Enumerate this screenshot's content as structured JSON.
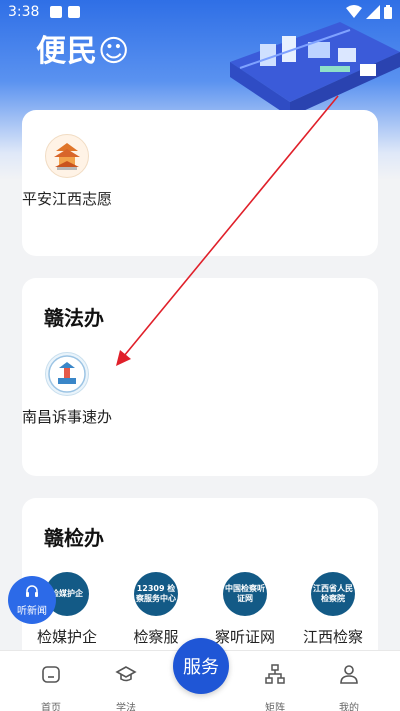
{
  "status_bar": {
    "time": "3:38"
  },
  "hero": {
    "title": "便民☺"
  },
  "sections": [
    {
      "title": "",
      "apps": [
        {
          "label": "平安江西志愿",
          "icon": "pavilion-icon"
        }
      ]
    },
    {
      "title": "赣法办",
      "apps": [
        {
          "label": "南昌诉事速办",
          "icon": "court-emblem-icon"
        }
      ]
    },
    {
      "title": "赣检办",
      "apps": [
        {
          "label": "检媒护企",
          "icon_text": "检媒护企"
        },
        {
          "label": "检察服",
          "icon_text": "12309 检察服务中心"
        },
        {
          "label": "察听证网",
          "icon_text": "中国检察听证网"
        },
        {
          "label": "江西检察",
          "icon_text": "江西省人民检察院"
        }
      ]
    }
  ],
  "floating": {
    "listen_news": "听新闻"
  },
  "bottom_nav": {
    "items": [
      {
        "label": "首页"
      },
      {
        "label": "学法"
      },
      {
        "label": "矩阵"
      },
      {
        "label": "我的"
      }
    ],
    "service": "服务"
  },
  "colors": {
    "primary": "#1f56d6",
    "arrow": "#e0202a"
  }
}
